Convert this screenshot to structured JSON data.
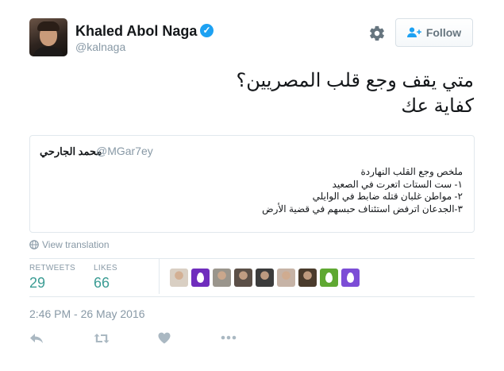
{
  "header": {
    "display_name": "Khaled Abol Naga",
    "verified_mark": "✓",
    "handle": "@kalnaga",
    "follow_label": "Follow"
  },
  "tweet": {
    "lines": [
      "متي يقف وجع قلب المصريين؟",
      "كفاية عك"
    ]
  },
  "quoted_tweet": {
    "name": "محمد الجارحي",
    "handle": "@MGar7ey",
    "lines": [
      "ملخص وجع القلب النهاردة",
      "١- ست الستات اتعرت في الصعيد",
      "٢- مواطن غلبان قتله ضابط في الوايلي",
      "٣-الجدعان اترفض استئناف حبسهم في قضية الأرض"
    ]
  },
  "view_translation": "View translation",
  "stats": {
    "retweets_label": "RETWEETS",
    "retweets_value": "29",
    "likes_label": "LIKES",
    "likes_value": "66"
  },
  "likers": [
    {
      "icon": "photo",
      "color": "#d9cfc3"
    },
    {
      "icon": "egg",
      "color": "#6f2dbd"
    },
    {
      "icon": "photo",
      "color": "#9a958c"
    },
    {
      "icon": "photo",
      "color": "#5b4f47"
    },
    {
      "icon": "photo",
      "color": "#3b3b3b"
    },
    {
      "icon": "photo",
      "color": "#c6b3a6"
    },
    {
      "icon": "photo",
      "color": "#4a3b2c"
    },
    {
      "icon": "egg",
      "color": "#5fa832"
    },
    {
      "icon": "egg",
      "color": "#7c4dd6"
    }
  ],
  "timestamp": "2:46 PM - 26 May 2016",
  "icons": {
    "settings": "gear-icon",
    "follow": "person-add-icon",
    "globe": "globe-icon",
    "reply": "reply-icon",
    "retweet": "retweet-icon",
    "like": "heart-icon",
    "more": "more-icon"
  },
  "colors": {
    "accent": "#1da1f2",
    "stat_value": "#3b9c94",
    "muted": "#8899a6",
    "action_icon": "#aab8c2"
  }
}
